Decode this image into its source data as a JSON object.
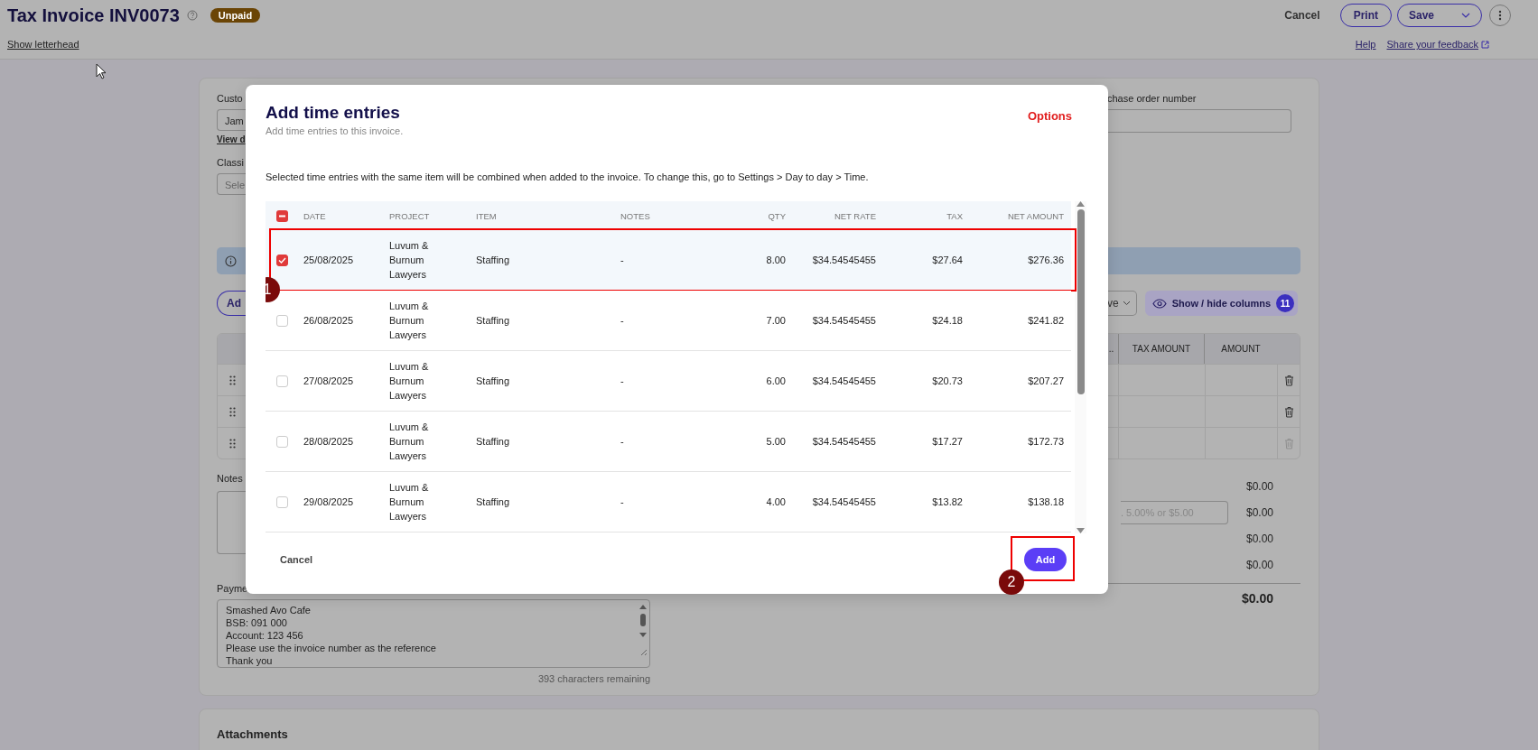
{
  "header": {
    "title": "Tax Invoice INV0073",
    "status": "Unpaid",
    "letterhead_link": "Show letterhead",
    "actions": [
      {
        "kind": "text",
        "label": "Cancel"
      },
      {
        "kind": "outline",
        "label": "Print"
      },
      {
        "kind": "split",
        "label": "Save"
      },
      {
        "kind": "more"
      }
    ],
    "links": [
      {
        "label": "Help",
        "external": false
      },
      {
        "label": "Share your feedback",
        "external": true
      }
    ]
  },
  "form": {
    "customer_label": "Custo",
    "customer_value": "Jam",
    "customer_link": "View d",
    "classification_label": "Classi",
    "classification_placeholder": "Sele",
    "po_label": "chase order number",
    "add_button": "Ad",
    "layout_dropdown": "ve",
    "columns_button": {
      "label": "Show / hide columns",
      "count": "11"
    },
    "lines_table": {
      "columns": [
        "...",
        "TAX AMOUNT",
        "AMOUNT"
      ],
      "rows": [
        {
          "deletable": true
        },
        {
          "deletable": true
        },
        {
          "deletable": false
        }
      ]
    },
    "notes_label": "Notes",
    "totals": [
      {
        "kind": "line",
        "value": "$0.00"
      },
      {
        "kind": "input",
        "value": "$0.00",
        "placeholder": ". 5.00% or $5.00"
      },
      {
        "kind": "line",
        "value": "$0.00"
      },
      {
        "kind": "line",
        "value": "$0.00"
      },
      {
        "kind": "total",
        "value": "$0.00"
      }
    ],
    "payment_label": "Payme",
    "payment_text": "Smashed Avo Cafe\nBSB: 091 000\nAccount: 123 456\nPlease use the invoice number as the reference\nThank you",
    "chars_remaining": "393 characters remaining",
    "attachments_title": "Attachments"
  },
  "modal": {
    "title": "Add time entries",
    "subtitle": "Add time entries to this invoice.",
    "options": "Options",
    "info": "Selected time entries with the same item will be combined when added to the invoice. To change this, go to Settings > Day to day > Time.",
    "select_all": {
      "indeterminate": true
    },
    "columns": [
      "DATE",
      "PROJECT",
      "ITEM",
      "NOTES",
      "QTY",
      "NET RATE",
      "TAX",
      "NET AMOUNT"
    ],
    "rows": [
      {
        "date": "25/08/2025",
        "project": "Luvum & Burnum Lawyers",
        "item": "Staffing",
        "notes": "-",
        "qty": "8.00",
        "net_rate": "$34.54545455",
        "tax": "$27.64",
        "net_amount": "$276.36",
        "selected": true,
        "callout": "1"
      },
      {
        "date": "26/08/2025",
        "project": "Luvum & Burnum Lawyers",
        "item": "Staffing",
        "notes": "-",
        "qty": "7.00",
        "net_rate": "$34.54545455",
        "tax": "$24.18",
        "net_amount": "$241.82",
        "selected": false
      },
      {
        "date": "27/08/2025",
        "project": "Luvum & Burnum Lawyers",
        "item": "Staffing",
        "notes": "-",
        "qty": "6.00",
        "net_rate": "$34.54545455",
        "tax": "$20.73",
        "net_amount": "$207.27",
        "selected": false
      },
      {
        "date": "28/08/2025",
        "project": "Luvum & Burnum Lawyers",
        "item": "Staffing",
        "notes": "-",
        "qty": "5.00",
        "net_rate": "$34.54545455",
        "tax": "$17.27",
        "net_amount": "$172.73",
        "selected": false
      },
      {
        "date": "29/08/2025",
        "project": "Luvum & Burnum Lawyers",
        "item": "Staffing",
        "notes": "-",
        "qty": "4.00",
        "net_rate": "$34.54545455",
        "tax": "$13.82",
        "net_amount": "$138.18",
        "selected": false
      }
    ],
    "cancel": "Cancel",
    "add": {
      "label": "Add",
      "callout": "2"
    }
  }
}
